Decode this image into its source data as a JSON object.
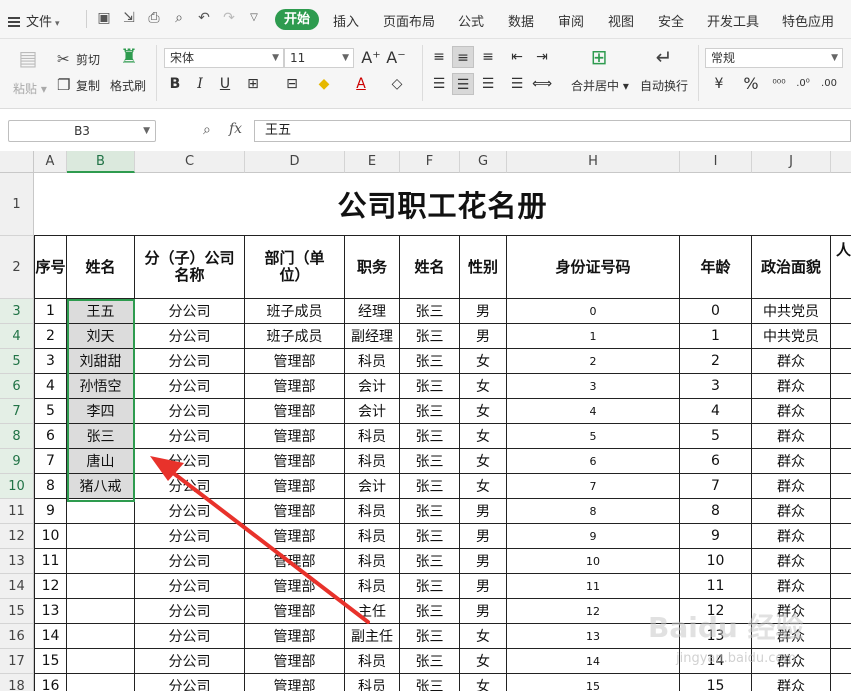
{
  "menu": {
    "file_label": "文件",
    "tabs": [
      "开始",
      "插入",
      "页面布局",
      "公式",
      "数据",
      "审阅",
      "视图",
      "安全",
      "开发工具",
      "特色应用"
    ],
    "active_tab": "开始"
  },
  "ribbon": {
    "paste": "粘贴",
    "cut": "剪切",
    "copy": "复制",
    "format_painter": "格式刷",
    "font_name": "宋体",
    "font_size": "11",
    "merge_center": "合并居中",
    "wrap_text": "自动换行",
    "number_format": "常规"
  },
  "formula_bar": {
    "cell_ref": "B3",
    "fx": "fx",
    "content": "王五"
  },
  "sheet": {
    "columns": [
      "A",
      "B",
      "C",
      "D",
      "E",
      "F",
      "G",
      "H",
      "I",
      "J"
    ],
    "selected_column": "B",
    "title": "公司职工花名册",
    "headers": [
      "序号",
      "姓名",
      "分（子）公司名称",
      "部门（单位）",
      "职务",
      "姓名",
      "性别",
      "身份证号码",
      "年龄",
      "政治面貌",
      "人（"
    ],
    "rows": [
      {
        "row": "3",
        "no": "1",
        "name": "王五",
        "company": "分公司",
        "dept": "班子成员",
        "title": "经理",
        "name2": "张三",
        "gender": "男",
        "id": "0",
        "age": "0",
        "political": "中共党员"
      },
      {
        "row": "4",
        "no": "2",
        "name": "刘天",
        "company": "分公司",
        "dept": "班子成员",
        "title": "副经理",
        "name2": "张三",
        "gender": "男",
        "id": "1",
        "age": "1",
        "political": "中共党员"
      },
      {
        "row": "5",
        "no": "3",
        "name": "刘甜甜",
        "company": "分公司",
        "dept": "管理部",
        "title": "科员",
        "name2": "张三",
        "gender": "女",
        "id": "2",
        "age": "2",
        "political": "群众"
      },
      {
        "row": "6",
        "no": "4",
        "name": "孙悟空",
        "company": "分公司",
        "dept": "管理部",
        "title": "会计",
        "name2": "张三",
        "gender": "女",
        "id": "3",
        "age": "3",
        "political": "群众"
      },
      {
        "row": "7",
        "no": "5",
        "name": "李四",
        "company": "分公司",
        "dept": "管理部",
        "title": "会计",
        "name2": "张三",
        "gender": "女",
        "id": "4",
        "age": "4",
        "political": "群众"
      },
      {
        "row": "8",
        "no": "6",
        "name": "张三",
        "company": "分公司",
        "dept": "管理部",
        "title": "科员",
        "name2": "张三",
        "gender": "女",
        "id": "5",
        "age": "5",
        "political": "群众"
      },
      {
        "row": "9",
        "no": "7",
        "name": "唐山",
        "company": "分公司",
        "dept": "管理部",
        "title": "科员",
        "name2": "张三",
        "gender": "女",
        "id": "6",
        "age": "6",
        "political": "群众"
      },
      {
        "row": "10",
        "no": "8",
        "name": "猪八戒",
        "company": "分公司",
        "dept": "管理部",
        "title": "会计",
        "name2": "张三",
        "gender": "女",
        "id": "7",
        "age": "7",
        "political": "群众"
      },
      {
        "row": "11",
        "no": "9",
        "name": "",
        "company": "分公司",
        "dept": "管理部",
        "title": "科员",
        "name2": "张三",
        "gender": "男",
        "id": "8",
        "age": "8",
        "political": "群众"
      },
      {
        "row": "12",
        "no": "10",
        "name": "",
        "company": "分公司",
        "dept": "管理部",
        "title": "科员",
        "name2": "张三",
        "gender": "男",
        "id": "9",
        "age": "9",
        "political": "群众"
      },
      {
        "row": "13",
        "no": "11",
        "name": "",
        "company": "分公司",
        "dept": "管理部",
        "title": "科员",
        "name2": "张三",
        "gender": "男",
        "id": "10",
        "age": "10",
        "political": "群众"
      },
      {
        "row": "14",
        "no": "12",
        "name": "",
        "company": "分公司",
        "dept": "管理部",
        "title": "科员",
        "name2": "张三",
        "gender": "男",
        "id": "11",
        "age": "11",
        "political": "群众"
      },
      {
        "row": "15",
        "no": "13",
        "name": "",
        "company": "分公司",
        "dept": "管理部",
        "title": "主任",
        "name2": "张三",
        "gender": "男",
        "id": "12",
        "age": "12",
        "political": "群众"
      },
      {
        "row": "16",
        "no": "14",
        "name": "",
        "company": "分公司",
        "dept": "管理部",
        "title": "副主任",
        "name2": "张三",
        "gender": "女",
        "id": "13",
        "age": "13",
        "political": "群众"
      },
      {
        "row": "17",
        "no": "15",
        "name": "",
        "company": "分公司",
        "dept": "管理部",
        "title": "科员",
        "name2": "张三",
        "gender": "女",
        "id": "14",
        "age": "14",
        "political": "群众"
      },
      {
        "row": "18",
        "no": "16",
        "name": "",
        "company": "分公司",
        "dept": "管理部",
        "title": "科员",
        "name2": "张三",
        "gender": "女",
        "id": "15",
        "age": "15",
        "political": "群众"
      }
    ]
  },
  "colors": {
    "accent": "#2e9b4f",
    "arrow": "#e8322b",
    "selection": "#dcdcdc"
  },
  "watermark": {
    "text": "Baidu 经验",
    "sub": "jingyan.baidu.com"
  }
}
